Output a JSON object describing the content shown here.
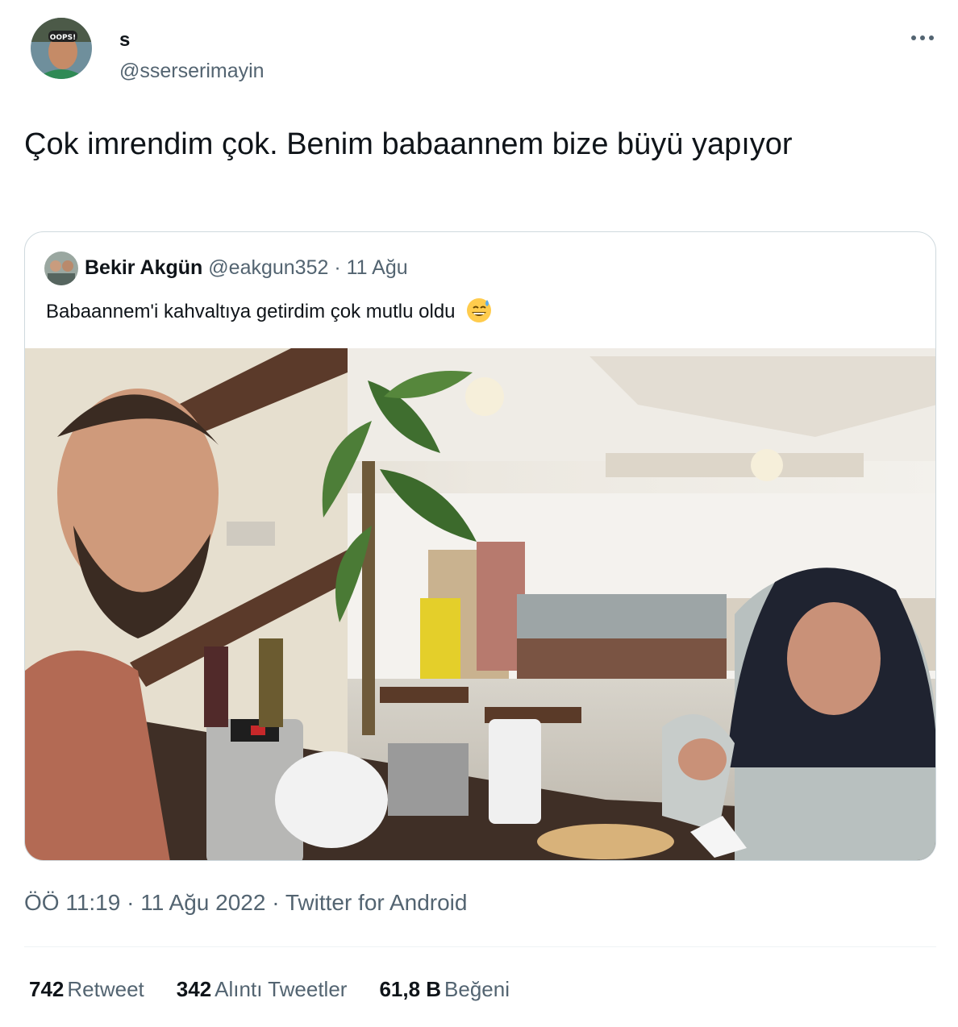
{
  "tweet": {
    "author": {
      "name": "s",
      "handle": "@sserserimayin",
      "avatar_icon": "user-avatar-icon"
    },
    "text": "Çok imrendim çok. Benim babaannem bize büyü yapıyor",
    "more_icon": "more-horizontal-icon",
    "quoted": {
      "name": "Bekir Akgün",
      "handle": "@eakgun352",
      "separator": "·",
      "date": "11 Ağu",
      "text": "Babaannem'i kahvaltıya getirdim çok mutlu oldu",
      "emoji_icon": "grinning-sweat-emoji",
      "photo_icon": "breakfast-photo"
    },
    "meta": {
      "time": "ÖÖ 11:19",
      "date": "11 Ağu 2022",
      "sep1": "·",
      "sep2": "·",
      "source": "Twitter for Android"
    },
    "stats": [
      {
        "count": "742",
        "label": "Retweet"
      },
      {
        "count": "342",
        "label": "Alıntı Tweetler"
      },
      {
        "count": "61,8 B",
        "label": "Beğeni"
      }
    ]
  }
}
